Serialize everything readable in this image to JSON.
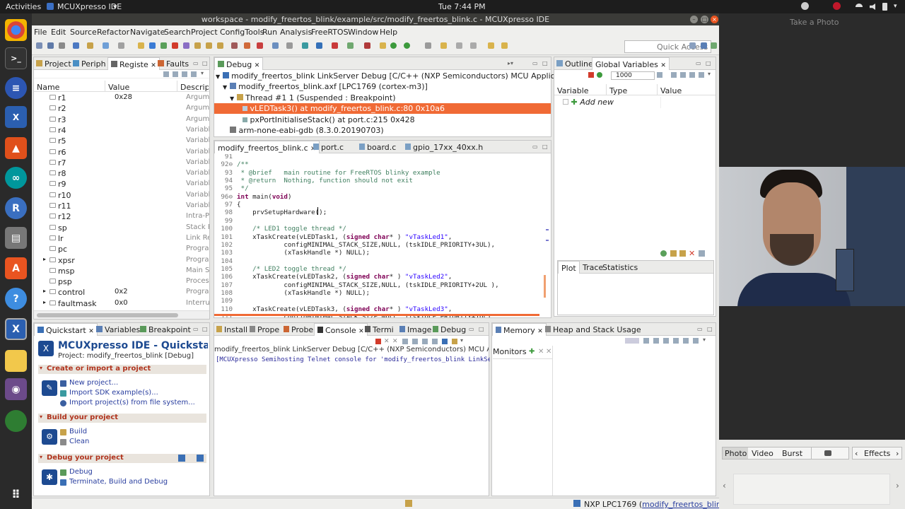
{
  "topbar": {
    "activities": "Activities",
    "app": "MCUXpresso IDE",
    "app_arrow": "▾",
    "clock": "Tue  7:44 PM"
  },
  "window": {
    "title": "workspace - modify_freertos_blink/example/src/modify_freertos_blink.c - MCUXpresso IDE"
  },
  "menu": [
    "File",
    "Edit",
    "Source",
    "Refactor",
    "Navigate",
    "Search",
    "Project",
    "ConfigTools",
    "Run",
    "Analysis",
    "FreeRTOS",
    "Window",
    "Help"
  ],
  "toolbar": {
    "quick_access": "Quick Access"
  },
  "left_panel": {
    "tabs": [
      "Project",
      "Periph",
      "Registe",
      "Faults"
    ],
    "columns": [
      "Name",
      "Value",
      "Descriptio"
    ],
    "rows": [
      {
        "name": "r1",
        "value": "0x28",
        "desc": "Argume"
      },
      {
        "name": "r2",
        "value": "",
        "desc": "Argume"
      },
      {
        "name": "r3",
        "value": "",
        "desc": "Argume"
      },
      {
        "name": "r4",
        "value": "",
        "desc": "Variabl"
      },
      {
        "name": "r5",
        "value": "",
        "desc": "Variabl"
      },
      {
        "name": "r6",
        "value": "",
        "desc": "Variabl"
      },
      {
        "name": "r7",
        "value": "",
        "desc": "Variabl"
      },
      {
        "name": "r8",
        "value": "",
        "desc": "Variabl"
      },
      {
        "name": "r9",
        "value": "",
        "desc": "Variabl"
      },
      {
        "name": "r10",
        "value": "",
        "desc": "Variabl"
      },
      {
        "name": "r11",
        "value": "",
        "desc": "Variabl"
      },
      {
        "name": "r12",
        "value": "",
        "desc": "Intra-Pr"
      },
      {
        "name": "sp",
        "value": "",
        "desc": "Stack P"
      },
      {
        "name": "lr",
        "value": "",
        "desc": "Link Re"
      },
      {
        "name": "pc",
        "value": "",
        "desc": "Progra"
      },
      {
        "name": "xpsr",
        "value": "",
        "desc": "Progra"
      },
      {
        "name": "msp",
        "value": "",
        "desc": "Main St"
      },
      {
        "name": "psp",
        "value": "",
        "desc": "Process"
      },
      {
        "name": "control",
        "value": "0x2",
        "desc": "Progra"
      },
      {
        "name": "faultmask",
        "value": "0x0",
        "desc": "Interru"
      }
    ]
  },
  "debug_panel": {
    "tab": "Debug",
    "tree": [
      "modify_freertos_blink LinkServer Debug [C/C++ (NXP Semiconductors) MCU Application]",
      "modify_freertos_blink.axf [LPC1769 (cortex-m3)]",
      "Thread #1 1 (Suspended : Breakpoint)",
      "vLEDTask3() at modify_freertos_blink.c:80 0x10a6",
      "pxPortInitialiseStack() at port.c:215 0x428",
      "arm-none-eabi-gdb (8.3.0.20190703)"
    ]
  },
  "outline_panel": {
    "tabs": [
      "Outline",
      "Global Variables"
    ],
    "count": "1000",
    "columns": [
      "Variable",
      "Type",
      "Value"
    ],
    "add_new": "Add new"
  },
  "plot_panel": {
    "tabs": [
      "Plot",
      "Trace",
      "Statistics"
    ]
  },
  "editor": {
    "tabs": [
      "modify_freertos_blink.c",
      "port.c",
      "board.c",
      "gpio_17xx_40xx.h"
    ],
    "lines": [
      {
        "n": "91",
        "t": ""
      },
      {
        "n": "92⊖",
        "t": "/**"
      },
      {
        "n": "93",
        "t": " * @brief   main routine for FreeRTOS blinky example"
      },
      {
        "n": "94",
        "t": " * @return  Nothing, function should not exit"
      },
      {
        "n": "95",
        "t": " */"
      },
      {
        "n": "96⊖",
        "t": "int main(void)"
      },
      {
        "n": "97",
        "t": "{"
      },
      {
        "n": "98",
        "t": "    prvSetupHardware();"
      },
      {
        "n": "99",
        "t": ""
      },
      {
        "n": "100",
        "t": "    /* LED1 toggle thread */"
      },
      {
        "n": "101",
        "t": "    xTaskCreate(vLEDTask1, (signed char* ) \"vTaskLed1\","
      },
      {
        "n": "102",
        "t": "            configMINIMAL_STACK_SIZE,NULL, (tskIDLE_PRIORITY+3UL),"
      },
      {
        "n": "103",
        "t": "            (xTaskHandle *) NULL);"
      },
      {
        "n": "104",
        "t": ""
      },
      {
        "n": "105",
        "t": "    /* LED2 toggle thread */"
      },
      {
        "n": "106",
        "t": "    xTaskCreate(vLEDTask2, (signed char* ) \"vTaskLed2\","
      },
      {
        "n": "107",
        "t": "            configMINIMAL_STACK_SIZE,NULL, (tskIDLE_PRIORITY+2UL ),"
      },
      {
        "n": "108",
        "t": "            (xTaskHandle *) NULL);"
      },
      {
        "n": "109",
        "t": ""
      },
      {
        "n": "110",
        "t": "    xTaskCreate(vLEDTask3, (signed char* ) \"vTaskLed3\","
      },
      {
        "n": "111",
        "t": "            configMINIMAL_STACK_SIZE,NULL, (tskIDLE_PRIORITY+1UL),"
      }
    ]
  },
  "quickstart": {
    "tabs": [
      "Quickstart",
      "Variables",
      "Breakpoint"
    ],
    "title": "MCUXpresso IDE - Quickstart Pa",
    "project": "Project: modify_freertos_blink [Debug]",
    "sections": [
      {
        "title": "Create or import a project",
        "links": [
          "New project...",
          "Import SDK example(s)...",
          "Import project(s) from file system..."
        ]
      },
      {
        "title": "Build your project",
        "links": [
          "Build",
          "Clean"
        ]
      },
      {
        "title": "Debug your project",
        "links": [
          "Debug",
          "Terminate, Build and Debug"
        ]
      }
    ]
  },
  "console": {
    "tabs": [
      "Install",
      "Prope",
      "Probe",
      "Console",
      "Termi",
      "Image",
      "Debug"
    ],
    "header": "modify_freertos_blink LinkServer Debug [C/C++ (NXP Semiconductors) MCU Applicatio",
    "line": "[MCUXpresso Semihosting Telnet console for 'modify_freertos_blink LinkSer"
  },
  "memory": {
    "tabs": [
      "Memory",
      "Heap and Stack Usage"
    ],
    "monitors": "Monitors"
  },
  "status": {
    "prefix": "NXP LPC1769 (",
    "link": "modify_freertos_blink",
    "suffix": ")"
  },
  "cheese": {
    "title": "Take a Photo",
    "modes": [
      "Photo",
      "Video",
      "Burst"
    ],
    "effects": "Effects"
  }
}
